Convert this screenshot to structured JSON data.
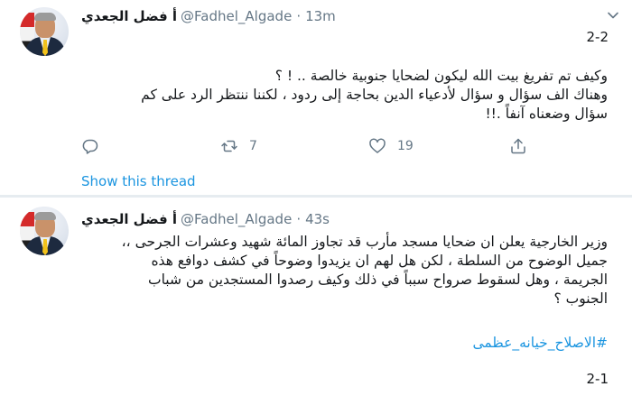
{
  "tweets": [
    {
      "display_name": "أ فضل الجعدي",
      "handle": "@Fadhel_Algade",
      "separator": "·",
      "time": "13m",
      "thread_label": "2-2",
      "lines": [
        "وكيف تم تفريغ بيت الله ليكون لضحايا جنوبية خالصة .. ! ؟",
        "وهناك الف سؤال و سؤال لأدعياء الدين بحاجة إلى ردود ، لكننا ننتظر الرد على كم",
        "سؤال وضعناه آنفاً .!!"
      ],
      "actions": {
        "reply_count": "",
        "retweet_count": "7",
        "like_count": "19"
      },
      "show_thread": "Show this thread",
      "icons": [
        "reply-icon",
        "retweet-icon",
        "like-icon",
        "share-icon",
        "chevron-down-icon"
      ]
    },
    {
      "display_name": "أ فضل الجعدي",
      "handle": "@Fadhel_Algade",
      "separator": "·",
      "time": "43s",
      "lines": [
        "وزير الخارجية يعلن ان ضحايا مسجد مأرب قد تجاوز المائة شهيد وعشرات الجرحى ،،",
        "جميل الوضوح من السلطة ، لكن هل لهم ان يزيدوا وضوحاً في كشف دوافع هذه",
        "الجريمة ، وهل لسقوط صرواح سبباً في ذلك وكيف رصدوا المستجدين من شباب",
        "الجنوب ؟"
      ],
      "hashtag": "#الاصلاح_خيانه_عظمى",
      "thread_label": "2-1"
    }
  ],
  "colors": {
    "text": "#14171a",
    "muted": "#657786",
    "link": "#1b95e0",
    "divider": "#e6ecf0"
  }
}
